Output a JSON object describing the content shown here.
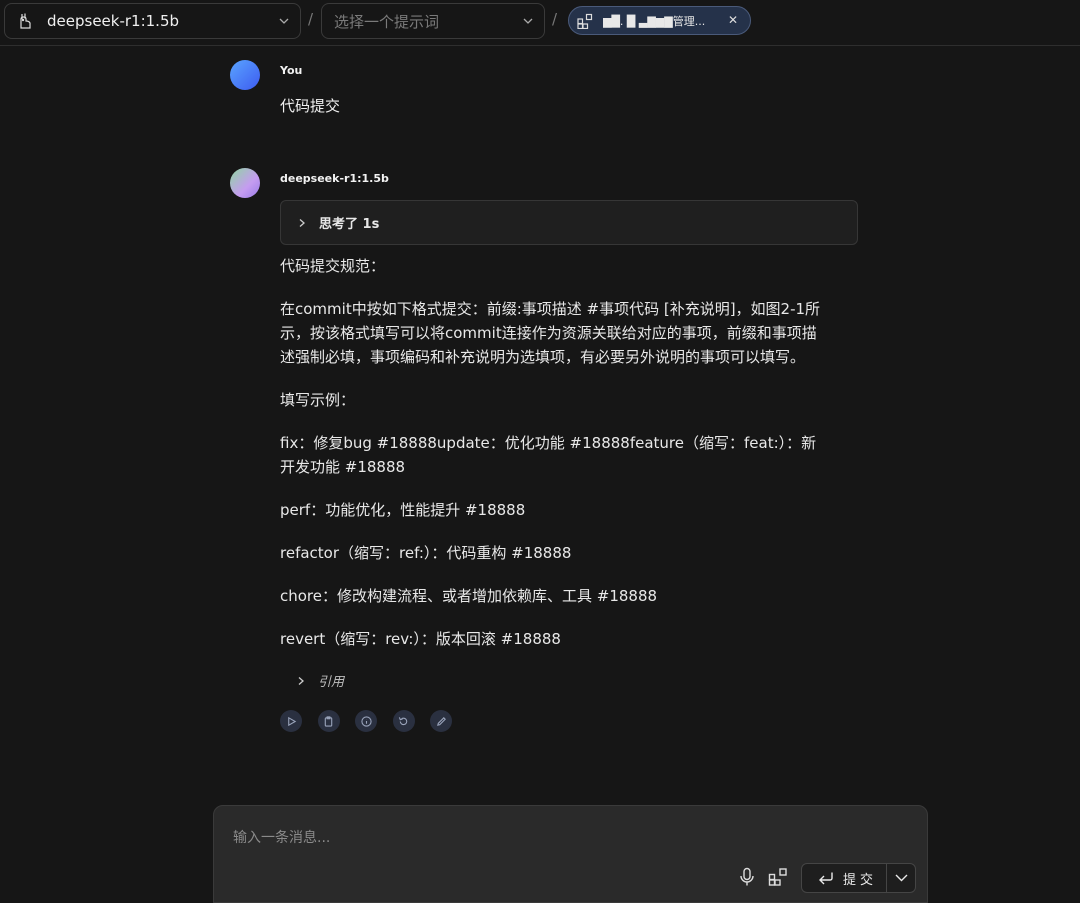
{
  "header": {
    "model_label": "deepseek-r1:1.5b",
    "separator": "/",
    "prompt_placeholder": "选择一个提示词",
    "chip_label": "▆█. █ ▃▇▆▇管理..."
  },
  "conversation": {
    "user_name": "You",
    "user_message": "代码提交",
    "bot_name": "deepseek-r1:1.5b",
    "thought_label": "思考了 1s",
    "paragraphs": [
      "代码提交规范：",
      "在commit中按如下格式提交：前缀:事项描述 #事项代码 [补充说明]，如图2-1所示，按该格式填写可以将commit连接作为资源关联给对应的事项，前缀和事项描述强制必填，事项编码和补充说明为选填项，有必要另外说明的事项可以填写。",
      "填写示例：",
      "fix：修复bug #18888update：优化功能 #18888feature（缩写：feat:）：新开发功能 #18888",
      "perf：功能优化，性能提升 #18888",
      "refactor（缩写：ref:）：代码重构 #18888",
      "chore：修改构建流程、或者增加依赖库、工具 #18888",
      "revert（缩写：rev:）：版本回滚 #18888"
    ],
    "quote_label": "引用"
  },
  "composer": {
    "placeholder": "输入一条消息...",
    "submit_label": "提交"
  },
  "icons": {
    "model": "llama-icon",
    "chip": "grid-plus-icon",
    "actions": [
      "play-icon",
      "clipboard-icon",
      "info-icon",
      "regenerate-icon",
      "edit-icon"
    ],
    "mic": "microphone-icon",
    "submit": "enter-icon"
  }
}
